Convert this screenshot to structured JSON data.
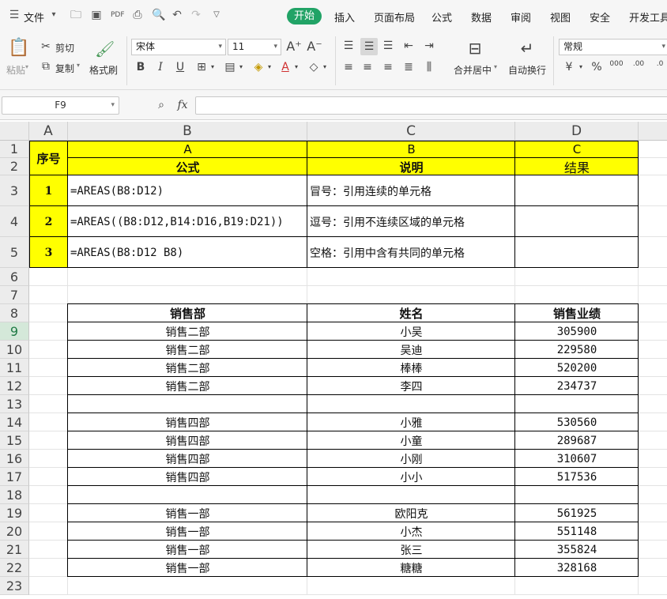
{
  "menu": {
    "file": "文件",
    "tabs": [
      "开始",
      "插入",
      "页面布局",
      "公式",
      "数据",
      "审阅",
      "视图",
      "安全",
      "开发工具"
    ]
  },
  "ribbon": {
    "paste": "粘贴",
    "cut": "剪切",
    "copy": "复制",
    "format_painter": "格式刷",
    "font_name": "宋体",
    "font_size": "11",
    "merge_center": "合并居中",
    "wrap_text": "自动换行",
    "number_format": "常规"
  },
  "formula_bar": {
    "name_box": "F9",
    "fx": "fx",
    "content": ""
  },
  "colors": {
    "accent": "#21a366",
    "highlight": "#ffff00"
  },
  "columns": [
    "A",
    "B",
    "C",
    "D"
  ],
  "rows": [
    "1",
    "2",
    "3",
    "4",
    "5",
    "6",
    "7",
    "8",
    "9",
    "10",
    "11",
    "12",
    "13",
    "14",
    "15",
    "16",
    "17",
    "18",
    "19",
    "20",
    "21",
    "22",
    "23"
  ],
  "selected_row": "9",
  "header": {
    "seq": "序号",
    "col_a": "A",
    "col_b": "B",
    "col_c": "C",
    "formula": "公式",
    "desc": "说明",
    "result": "结果"
  },
  "examples": [
    {
      "seq": "1",
      "formula": "=AREAS(B8:D12)",
      "desc": "冒号：引用连续的单元格",
      "result": ""
    },
    {
      "seq": "2",
      "formula": "=AREAS((B8:D12,B14:D16,B19:D21))",
      "desc": "逗号：引用不连续区域的单元格",
      "result": ""
    },
    {
      "seq": "3",
      "formula": "=AREAS(B8:D12 B8)",
      "desc": "空格：引用中含有共同的单元格",
      "result": ""
    }
  ],
  "sales_header": {
    "dept": "销售部",
    "name": "姓名",
    "perf": "销售业绩"
  },
  "sales": [
    {
      "dept": "销售二部",
      "name": "小吴",
      "perf": "305900"
    },
    {
      "dept": "销售二部",
      "name": "吴迪",
      "perf": "229580"
    },
    {
      "dept": "销售二部",
      "name": "棒棒",
      "perf": "520200"
    },
    {
      "dept": "销售二部",
      "name": "李四",
      "perf": "234737"
    },
    {
      "dept": "",
      "name": "",
      "perf": ""
    },
    {
      "dept": "销售四部",
      "name": "小雅",
      "perf": "530560"
    },
    {
      "dept": "销售四部",
      "name": "小童",
      "perf": "289687"
    },
    {
      "dept": "销售四部",
      "name": "小刚",
      "perf": "310607"
    },
    {
      "dept": "销售四部",
      "name": "小小",
      "perf": "517536"
    },
    {
      "dept": "",
      "name": "",
      "perf": ""
    },
    {
      "dept": "销售一部",
      "name": "欧阳克",
      "perf": "561925"
    },
    {
      "dept": "销售一部",
      "name": "小杰",
      "perf": "551148"
    },
    {
      "dept": "销售一部",
      "name": "张三",
      "perf": "355824"
    },
    {
      "dept": "销售一部",
      "name": "糖糖",
      "perf": "328168"
    }
  ]
}
